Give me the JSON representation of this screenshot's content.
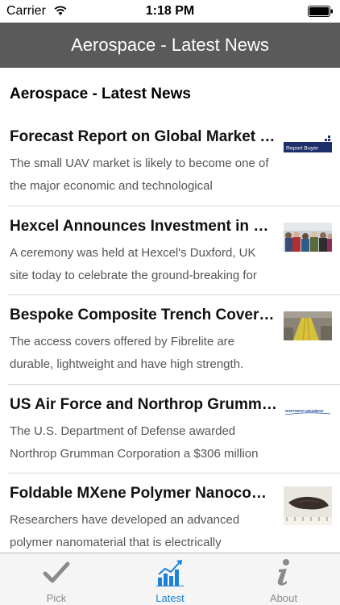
{
  "status": {
    "carrier": "Carrier",
    "time": "1:18 PM",
    "wifi_icon": "wifi-icon",
    "battery_icon": "battery-icon"
  },
  "nav": {
    "title": "Aerospace - Latest News"
  },
  "section_title": "Aerospace - Latest News",
  "news": [
    {
      "title": "Forecast Report on Global Market for Small UAV",
      "summary": "The small UAV market is likely to become one of the major economic and technological",
      "thumb_text": "Report Buyer"
    },
    {
      "title": "Hexcel Announces Investment in New Facility",
      "summary": "A ceremony was held at Hexcel's Duxford, UK site today to celebrate the ground-breaking for"
    },
    {
      "title": "Bespoke Composite Trench Covers Offered",
      "summary": "The access covers offered by Fibrelite are durable, lightweight and have high strength."
    },
    {
      "title": "US Air Force and Northrop Grumman Contract",
      "summary": "The U.S. Department of Defense awarded Northrop Grumman Corporation a $306 million",
      "thumb_text": "NORTHROP GRUMMAN"
    },
    {
      "title": "Foldable MXene Polymer Nanocomposite",
      "summary": "Researchers have developed an advanced polymer nanomaterial that is electrically"
    }
  ],
  "tabs": [
    {
      "label": "Pick",
      "icon": "checkmark-icon",
      "active": false
    },
    {
      "label": "Latest",
      "icon": "chart-icon",
      "active": true
    },
    {
      "label": "About",
      "icon": "info-icon",
      "active": false
    }
  ],
  "colors": {
    "nav_bg": "#5a5a5a",
    "tab_active": "#1a82d8",
    "tab_inactive": "#8a8a8a"
  }
}
